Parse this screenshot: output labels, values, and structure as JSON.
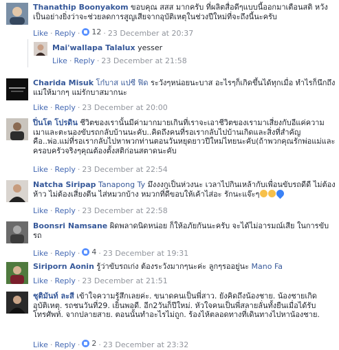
{
  "actions": {
    "like": "Like",
    "reply": "Reply",
    "dot": "·"
  },
  "comments": [
    {
      "name": "Thanathip Boonyakom",
      "text": " ขอบคุณ สสส มากครับ ที่ผลิตสื่อดีๆแบบนี้ออกมาเตือนสติ หวังเป็นอย่างยิ่งว่าจะช่วยลดการสูญเสียจากอุบัติเหตุในช่วงปีใหม่ที่จะถึงนี้นะครับ",
      "likes": "12",
      "time": "23 December at 20:37"
    },
    {
      "name": "Mai'wallapa Talalux",
      "text": " yesser",
      "time": "23 December at 21:58"
    },
    {
      "name": "Charida Misuk",
      "tag": " โก๋บาส แปซี ฟิด",
      "text": " ระวังๆหน่อยนะบาส อะไรๆก็เกิดขึ้นได้ทุกเมื่อ ทำไรก็นึกถึงแม่ให้มากๆ แม่รักบาสมากนะ",
      "time": "23 December at 20:00"
    },
    {
      "name": "ปิ่นโต โปรดิน",
      "text": " ชีวิตของเรานั้นมีค่ามากมายเกินที่เราจะเอาชีวิตของเรามาเสี่ยงกับอีแค่ความเมาและตะนองขับรถกลับบ้านนะคับ..คิดถึงคนที่รอเรากลับไปบ้านเกิดและสิ่งที่สำคัญคือ..พ่อ.แม่ที่รอเรากลับไปหาพวกท่านตอนวันหยุดยาวปีใหม่ไทยนะคับ(ถ้าพวกคุณรักพ่อแม่และครอบครัวจริงๆคุณต้องตั้งสติก่อนสตาดนะคับ",
      "time": "23 December at 22:54"
    },
    {
      "name": "Natcha Siripap",
      "tag": " Tanapong Ty",
      "text": " มึงงงกูเป็นห่วงนะ เวลาไปกินเหล้ากับเพื่อนขับรถดีดี ไม่ต้องห้าว ไม่ต้องเสี่ยงตีน ไส่หมวกบ้าง หมวกที่ดีขอบให้เค้าไส่อะ รักนะแจ๊ะๆ",
      "time": "23 December at 22:58"
    },
    {
      "name": "Boonsri Namsane",
      "text": " ผิดพลาดนิดหน่อย ก็ให้อภัยกันนะครับ จะได้ไม่อารมณ์เสีย ในการขับรถ",
      "likes": "4",
      "time": "23 December at 19:31"
    },
    {
      "name": "Siriporn Aonin",
      "text": " รู้ว่าขับรถเก่ง ต้องระวังมากๆนะค่ะ ลูกๆรออยู่นะ ",
      "tag": "Mano Fa",
      "time": "23 December at 21:51"
    },
    {
      "name": "ชุติมันท์ ละสี",
      "text": " เข้าใจความรู้สึกเลยค่ะ. ขนาดคนเป็นพี่สาว. ยังคิดถึงน้องชาย. น้องชายเกิดอุบัติเหตุ. รถชนวันที่29. เย็นพอดี. อีก2วันก็ปีใหม่. หัวใจคนเป็นพี่สลายลั่นทั้งยืนเมื่อได้รับโทรศัพท์. จากปลายสาย. ตอนนั้นทำอะไรไม่ถูก. ร้องไห้ตลอดทางที่เดินทางไปหาน้องชาย.",
      "likes": "2",
      "time": "23 December at 23:32"
    }
  ],
  "colors": {
    "link": "#365899",
    "action": "#4267b2",
    "meta": "#90949c",
    "like_badge": "#5890ff"
  }
}
